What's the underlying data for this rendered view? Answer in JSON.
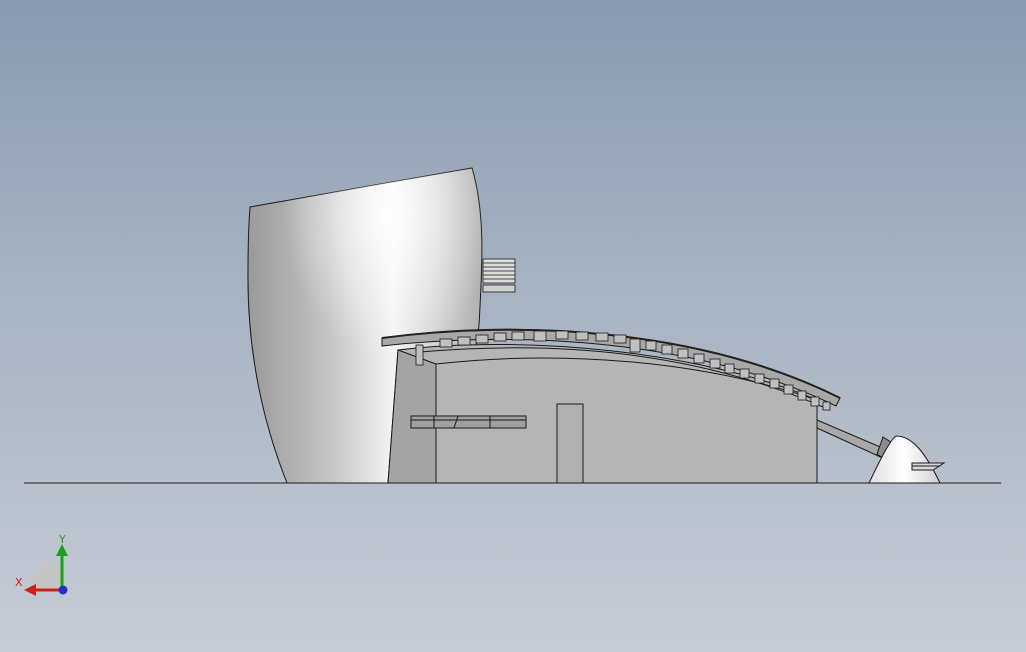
{
  "viewport": {
    "background_top": "#8a9bb0",
    "background_bottom": "#c6ccd6"
  },
  "triad": {
    "x_label": "X",
    "y_label": "Y",
    "x_color": "#d0201c",
    "y_color": "#1ea01e",
    "z_color": "#2030c8"
  },
  "model": {
    "tower_color": "#d4d4d4",
    "hall_color": "#b5b5b5",
    "edge_color": "#1a1a1a"
  }
}
